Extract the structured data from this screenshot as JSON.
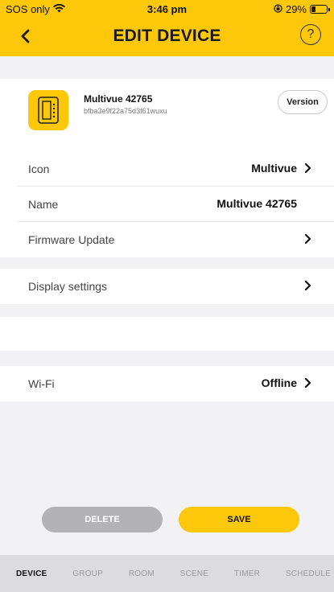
{
  "status_bar": {
    "carrier": "SOS only",
    "time": "3:46 pm",
    "battery_text": "29%",
    "battery_level": 0.29
  },
  "nav": {
    "title": "EDIT DEVICE",
    "help_symbol": "?",
    "back_icon": "chevron-left-icon",
    "help_icon": "question-circle-icon"
  },
  "device": {
    "name": "Multivue 42765",
    "id": "bfba3e9f22a75d3f61wuxu",
    "version_label": "Version",
    "icon": "thermostat-device-icon"
  },
  "settings": {
    "icon_label": "Icon",
    "icon_value": "Multivue",
    "name_label": "Name",
    "name_value": "Multivue 42765",
    "firmware_label": "Firmware Update",
    "display_label": "Display settings",
    "wifi_label": "Wi-Fi",
    "wifi_value": "Offline"
  },
  "buttons": {
    "delete": "DELETE",
    "save": "SAVE"
  },
  "tabs": [
    {
      "label": "DEVICE",
      "active": true
    },
    {
      "label": "GROUP",
      "active": false
    },
    {
      "label": "ROOM",
      "active": false
    },
    {
      "label": "SCENE",
      "active": false
    },
    {
      "label": "TIMER",
      "active": false
    },
    {
      "label": "SCHEDULE",
      "active": false
    }
  ],
  "colors": {
    "accent": "#fec80a",
    "delete_button": "#b3b3b5",
    "tab_bar": "#dcdcdf"
  }
}
